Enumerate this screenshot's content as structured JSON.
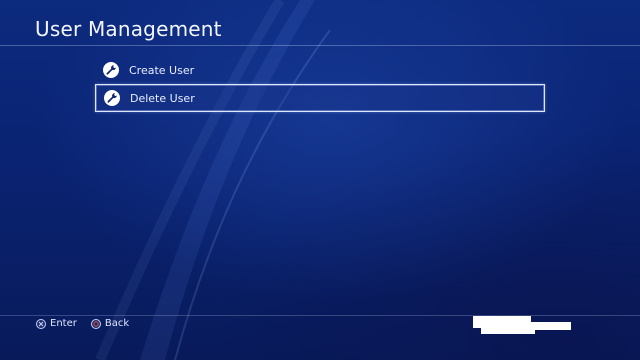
{
  "screen": {
    "title": "User Management"
  },
  "menu": {
    "items": [
      {
        "label": "Create User",
        "icon": "wrench-icon"
      },
      {
        "label": "Delete User",
        "icon": "wrench-icon",
        "selected": true
      }
    ]
  },
  "footer": {
    "hints": [
      {
        "label": "Enter",
        "icon": "cross-button-icon"
      },
      {
        "label": "Back",
        "icon": "circle-button-icon"
      }
    ]
  },
  "colors": {
    "background": "#0a2372",
    "text": "#ffffff",
    "selection_border": "#ebf0ff",
    "circle_button": "#e0504a"
  }
}
